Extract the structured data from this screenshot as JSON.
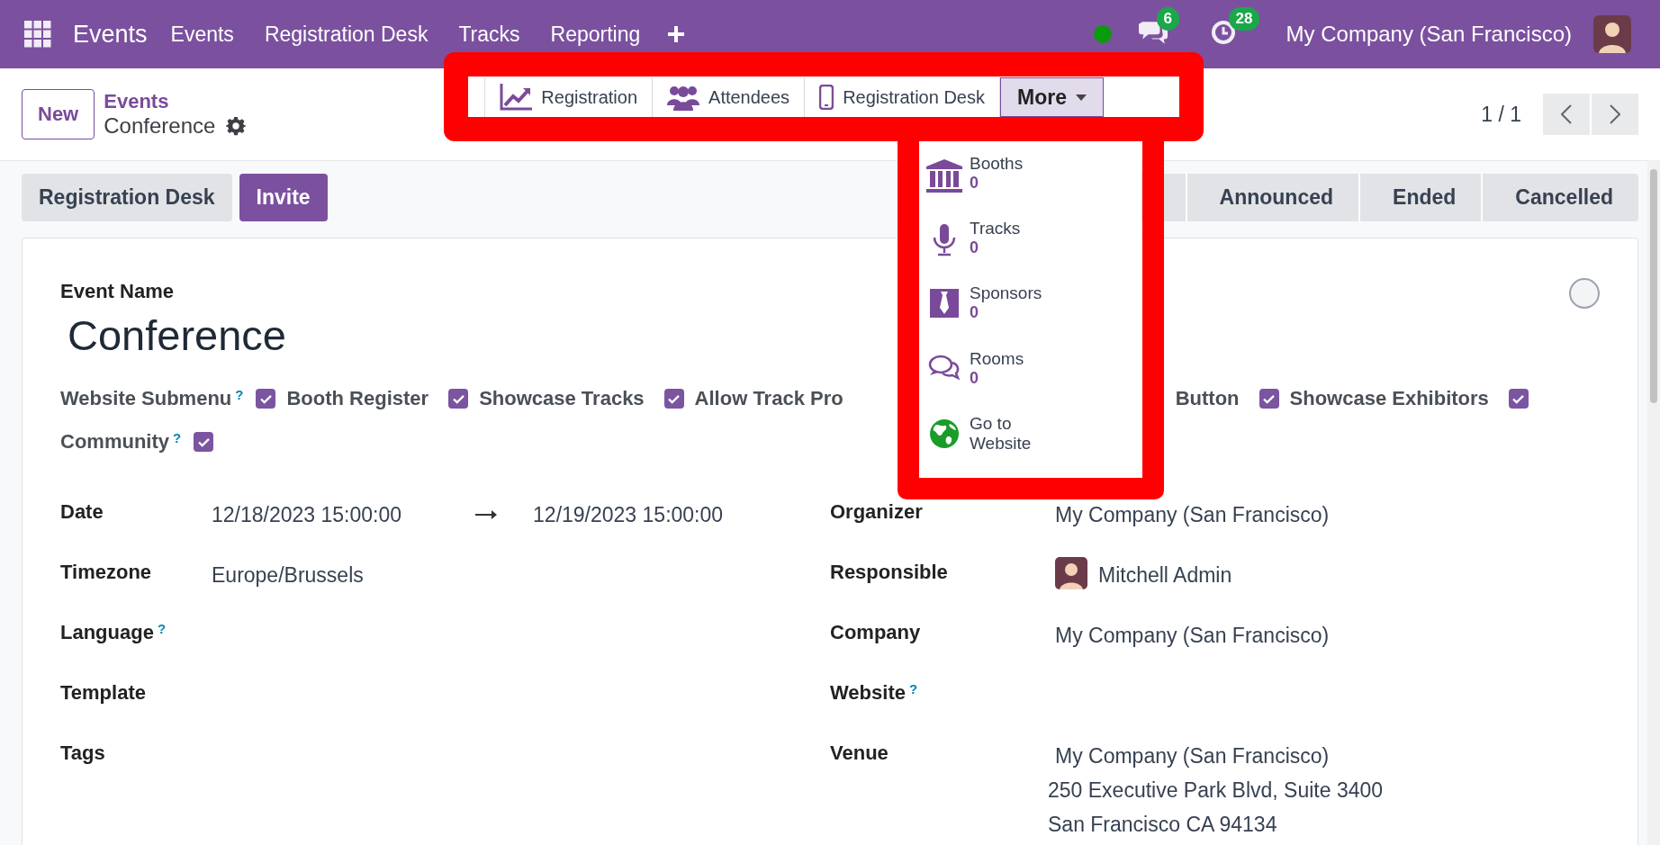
{
  "topbar": {
    "app_name": "Events",
    "menu": [
      "Events",
      "Registration Desk",
      "Tracks",
      "Reporting"
    ],
    "messages_count": "6",
    "activities_count": "28",
    "company": "My Company (San Francisco)"
  },
  "control_panel": {
    "new_button": "New",
    "breadcrumb": {
      "parent": "Events",
      "current": "Conference"
    },
    "smart_buttons": [
      {
        "label": "Registration"
      },
      {
        "label": "Attendees"
      },
      {
        "label": "Registration Desk"
      },
      {
        "label": "More",
        "expanded": true
      }
    ],
    "pager": "1 / 1"
  },
  "more_menu": [
    {
      "label": "Booths",
      "count": "0"
    },
    {
      "label": "Tracks",
      "count": "0"
    },
    {
      "label": "Sponsors",
      "count": "0"
    },
    {
      "label": "Rooms",
      "count": "0"
    },
    {
      "label": "Go to Website"
    }
  ],
  "status_bar": {
    "buttons": [
      {
        "label": "Registration Desk",
        "primary": false
      },
      {
        "label": "Invite",
        "primary": true
      }
    ],
    "stages": [
      {
        "label": "Announced",
        "selected": false
      },
      {
        "label": "Ended",
        "selected": false
      },
      {
        "label": "Cancelled",
        "selected": false
      }
    ]
  },
  "form": {
    "title_label": "Event Name",
    "title": "Conference",
    "options": [
      {
        "label": "Website Submenu",
        "help": "?",
        "checked": true
      },
      {
        "label": "Booth Register",
        "checked": true
      },
      {
        "label": "Showcase Tracks",
        "checked": true
      },
      {
        "label": "Allow Track Pro"
      },
      {
        "label": "Button",
        "checked": true
      },
      {
        "label": "Showcase Exhibitors",
        "checked": true
      },
      {
        "label": "Community",
        "help": "?",
        "checked": true
      }
    ],
    "left_fields": [
      {
        "label": "Date",
        "value": "12/18/2023 15:00:00",
        "end_value": "12/19/2023 15:00:00"
      },
      {
        "label": "Timezone",
        "value": "Europe/Brussels"
      },
      {
        "label": "Language",
        "help": "?"
      },
      {
        "label": "Template"
      },
      {
        "label": "Tags"
      }
    ],
    "right_fields": [
      {
        "label": "Organizer",
        "value": "My Company (San Francisco)"
      },
      {
        "label": "Responsible",
        "value": "Mitchell Admin",
        "avatar": true
      },
      {
        "label": "Company",
        "value": "My Company (San Francisco)"
      },
      {
        "label": "Website",
        "help": "?"
      },
      {
        "label": "Venue",
        "lines": [
          "My Company (San Francisco)",
          "250 Executive Park Blvd, Suite 3400",
          "San Francisco CA 94134"
        ]
      }
    ]
  }
}
